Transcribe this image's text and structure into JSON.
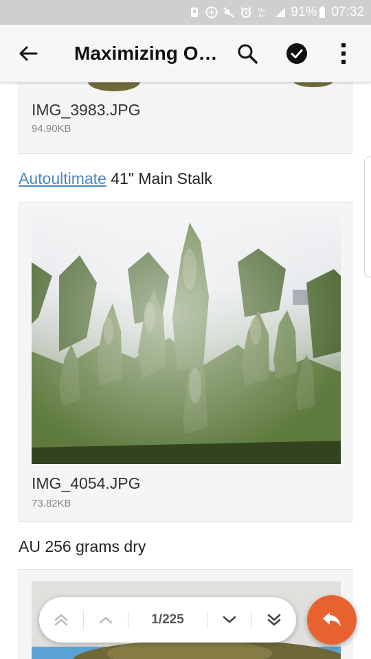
{
  "status_bar": {
    "battery_percent": "91%",
    "time": "07:32",
    "icons": [
      "storage-icon",
      "add-circle-icon",
      "mute-icon",
      "alarm-icon",
      "network-hplus-icon",
      "signal-icon",
      "battery-icon"
    ]
  },
  "app_bar": {
    "title": "Maximizing Outdoor Autoflower Yields",
    "icons": [
      "back-arrow-icon",
      "search-icon",
      "check-circle-icon",
      "more-vert-icon"
    ]
  },
  "posts": [
    {
      "type": "attachment",
      "file_name": "IMG_3983.JPG",
      "file_size": "94.90KB"
    },
    {
      "type": "text",
      "link_text": "Autoultimate",
      "text": " 41\" Main Stalk"
    },
    {
      "type": "attachment",
      "file_name": "IMG_4054.JPG",
      "file_size": "73.82KB"
    },
    {
      "type": "text",
      "text": "AU 256 grams dry"
    }
  ],
  "pager": {
    "page_indicator": "1/225",
    "icons": [
      "first-page-icon",
      "previous-page-icon",
      "next-page-icon",
      "last-page-icon"
    ]
  },
  "fab": {
    "icon": "reply-icon",
    "color": "#e8622f"
  },
  "colors": {
    "status_bar": "#cfcfcf",
    "app_bar": "#f7f7f7",
    "link": "#4a86c5",
    "card": "#f5f5f5",
    "accent": "#e8622f"
  }
}
